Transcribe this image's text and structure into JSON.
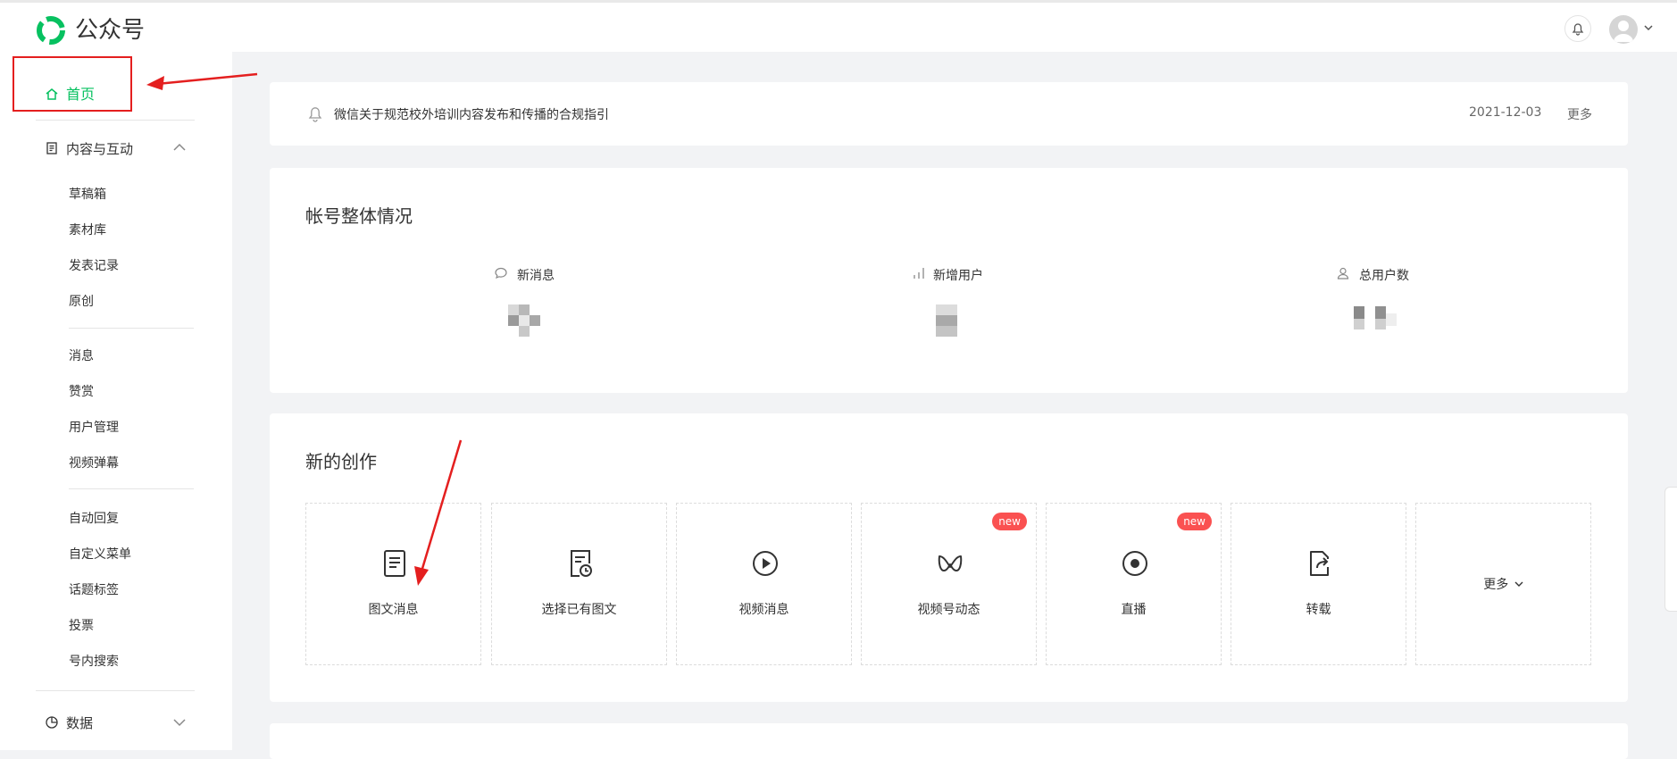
{
  "header": {
    "app_title": "公众号",
    "brand_color": "#07c160",
    "bell_icon": "bell-icon",
    "avatar_icon": "avatar-icon"
  },
  "sidebar": {
    "home_label": "首页",
    "content_section": {
      "label": "内容与互动",
      "expanded": true
    },
    "group1": [
      "草稿箱",
      "素材库",
      "发表记录",
      "原创"
    ],
    "group2": [
      "消息",
      "赞赏",
      "用户管理",
      "视频弹幕"
    ],
    "group3": [
      "自动回复",
      "自定义菜单",
      "话题标签",
      "投票",
      "号内搜索"
    ],
    "data_section": {
      "label": "数据",
      "expanded": false
    }
  },
  "notice": {
    "text": "微信关于规范校外培训内容发布和传播的合规指引",
    "date": "2021-12-03",
    "more": "更多"
  },
  "overview": {
    "title": "帐号整体情况",
    "stats": [
      {
        "label": "新消息",
        "icon": "chat-bubble-icon"
      },
      {
        "label": "新增用户",
        "icon": "bar-chart-icon"
      },
      {
        "label": "总用户数",
        "icon": "user-icon"
      }
    ]
  },
  "create": {
    "title": "新的创作",
    "tiles": [
      {
        "label": "图文消息",
        "icon": "document-icon",
        "badge": ""
      },
      {
        "label": "选择已有图文",
        "icon": "document-clock-icon",
        "badge": ""
      },
      {
        "label": "视频消息",
        "icon": "play-circle-icon",
        "badge": ""
      },
      {
        "label": "视频号动态",
        "icon": "channels-icon",
        "badge": "new"
      },
      {
        "label": "直播",
        "icon": "live-icon",
        "badge": "new"
      },
      {
        "label": "转载",
        "icon": "repost-icon",
        "badge": ""
      }
    ],
    "more_label": "更多"
  }
}
